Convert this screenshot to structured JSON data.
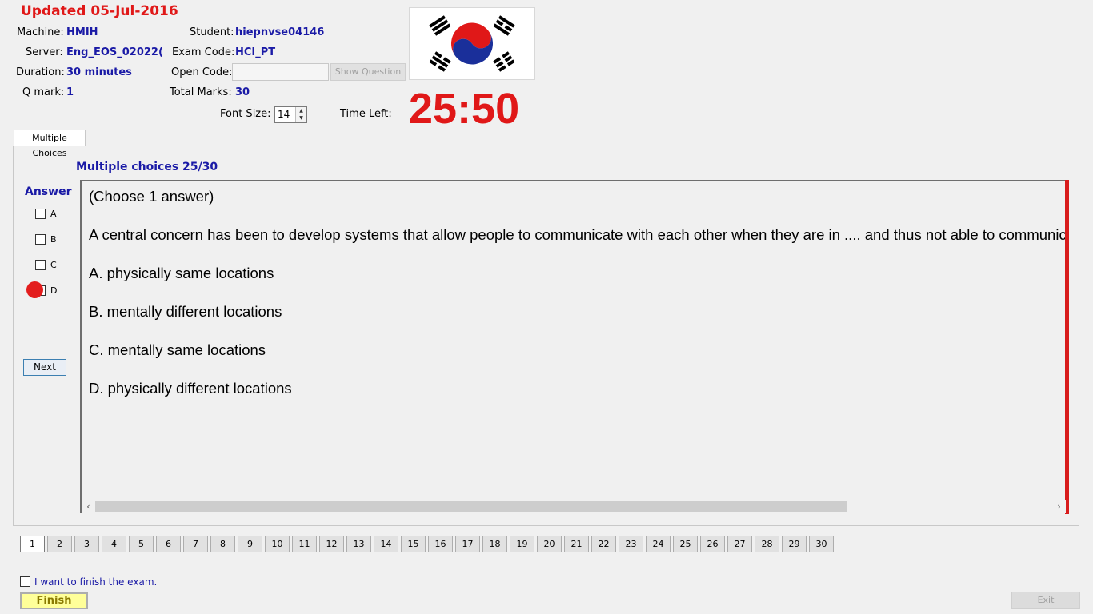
{
  "header": {
    "updated": "Updated 05-Jul-2016",
    "machine_label": "Machine:",
    "machine_value": "HMIH",
    "server_label": "Server:",
    "server_value": "Eng_EOS_02022(",
    "duration_label": "Duration:",
    "duration_value": "30 minutes",
    "qmark_label": "Q mark:",
    "qmark_value": "1",
    "student_label": "Student:",
    "student_value": "hiepnvse04146",
    "exam_code_label": "Exam Code:",
    "exam_code_value": "HCI_PT",
    "open_code_label": "Open Code:",
    "open_code_value": "",
    "show_question_label": "Show Question",
    "total_marks_label": "Total Marks:",
    "total_marks_value": "30",
    "font_size_label": "Font Size:",
    "font_size_value": "14",
    "time_left_label": "Time Left:",
    "time_left_value": "25:50"
  },
  "tab": {
    "label": "Multiple Choices"
  },
  "question": {
    "counter": "Multiple choices 25/30",
    "instruction": "(Choose 1 answer)",
    "stem": "A central concern has been to develop systems that allow people to communicate with each other when they are in .... and thus not able to communicate",
    "options": [
      "A.  physically same locations",
      "B.  mentally different locations",
      "C.  mentally same locations",
      "D.  physically different locations"
    ]
  },
  "answer_panel": {
    "title": "Answer",
    "choices": [
      "A",
      "B",
      "C",
      "D"
    ],
    "next_label": "Next"
  },
  "question_nav": [
    "1",
    "2",
    "3",
    "4",
    "5",
    "6",
    "7",
    "8",
    "9",
    "10",
    "11",
    "12",
    "13",
    "14",
    "15",
    "16",
    "17",
    "18",
    "19",
    "20",
    "21",
    "22",
    "23",
    "24",
    "25",
    "26",
    "27",
    "28",
    "29",
    "30"
  ],
  "footer": {
    "finish_check_label": "I want to finish the exam.",
    "finish_label": "Finish",
    "exit_label": "Exit"
  },
  "icons": {
    "flag": "south-korea-flag-icon",
    "scroll_left": "chevron-left-icon",
    "scroll_right": "chevron-right-icon"
  },
  "colors": {
    "accent_red": "#e01818",
    "label_blue": "#1a1aa6",
    "finish_yellow": "#ffff99"
  }
}
